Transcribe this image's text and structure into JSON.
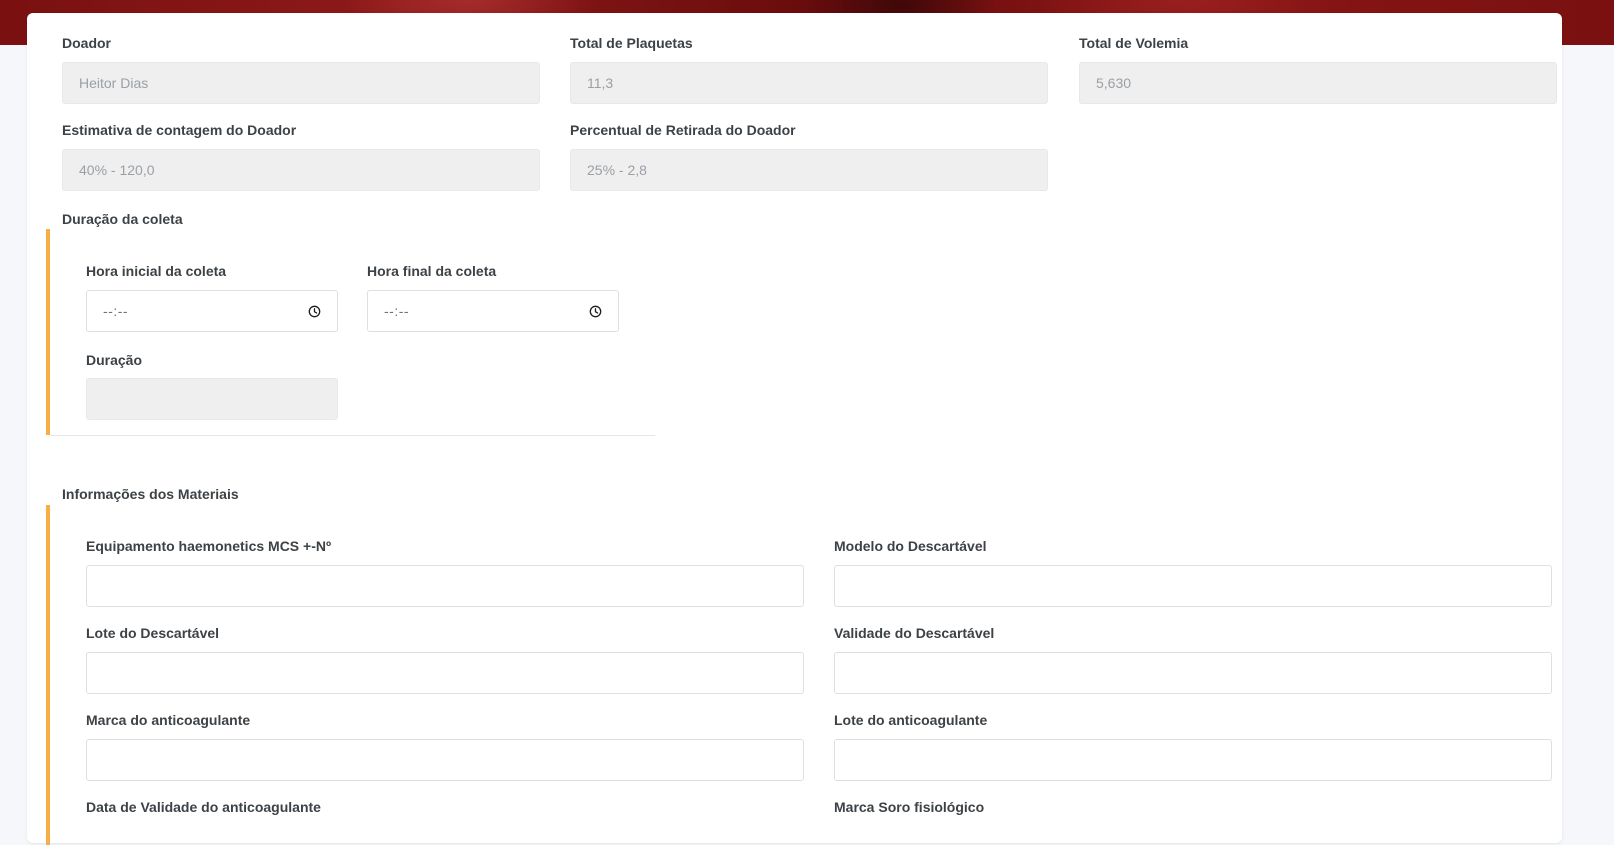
{
  "donor_info": {
    "donor": {
      "label": "Doador",
      "value": "Heitor Dias"
    },
    "total_platelets": {
      "label": "Total de Plaquetas",
      "value": "11,3"
    },
    "total_volemia": {
      "label": "Total de Volemia",
      "value": "5,630"
    },
    "count_estimate": {
      "label": "Estimativa de contagem do Doador",
      "value": "40% - 120,0"
    },
    "withdrawal_percentage": {
      "label": "Percentual de Retirada do Doador",
      "value": "25% - 2,8"
    }
  },
  "collection_duration": {
    "title": "Duração da coleta",
    "start_time": {
      "label": "Hora inicial da coleta",
      "placeholder": "--:--"
    },
    "end_time": {
      "label": "Hora final da coleta",
      "placeholder": "--:--"
    },
    "duration": {
      "label": "Duração",
      "value": ""
    }
  },
  "materials": {
    "title": "Informações dos Materiais",
    "equipment": {
      "label": "Equipamento haemonetics MCS +-Nº",
      "value": ""
    },
    "disposable_model": {
      "label": "Modelo do Descartável",
      "value": ""
    },
    "disposable_lot": {
      "label": "Lote do Descartável",
      "value": ""
    },
    "disposable_validity": {
      "label": "Validade do Descartável",
      "value": ""
    },
    "anticoagulant_brand": {
      "label": "Marca do anticoagulante",
      "value": ""
    },
    "anticoagulant_lot": {
      "label": "Lote do anticoagulante",
      "value": ""
    },
    "anticoagulant_validity": {
      "label": "Data de Validade do anticoagulante"
    },
    "saline_brand": {
      "label": "Marca Soro fisiológico"
    }
  },
  "icons": {
    "clock": "clock-icon"
  },
  "colors": {
    "accent": "#f7ae46",
    "banner": "#7a1010",
    "readonly_bg": "#efefef",
    "label_text": "#3d4246"
  }
}
